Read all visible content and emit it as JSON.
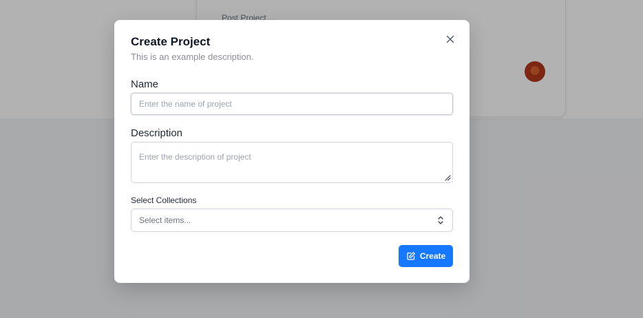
{
  "background": {
    "card_text": "Post Project…"
  },
  "modal": {
    "title": "Create Project",
    "subtitle": "This is an example description.",
    "close_icon": "close-icon",
    "name": {
      "label": "Name",
      "placeholder": "Enter the name of project",
      "value": ""
    },
    "description": {
      "label": "Description",
      "placeholder": "Enter the description of project",
      "value": ""
    },
    "collections": {
      "label": "Select Collections",
      "placeholder": "Select items...",
      "icon": "chevron-up-down-icon"
    },
    "create_button": {
      "label": "Create",
      "icon": "edit-icon",
      "color": "#1677ff"
    }
  }
}
